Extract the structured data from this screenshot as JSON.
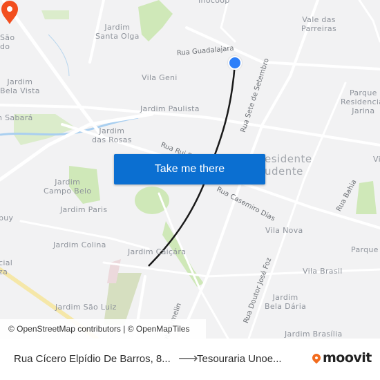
{
  "map": {
    "neighborhoods": [
      {
        "id": "inocoop",
        "text": "Inocoop"
      },
      {
        "id": "sao-do",
        "text": "São\ndo"
      },
      {
        "id": "jardim-santa-olga",
        "text": "Jardim\nSanta Olga"
      },
      {
        "id": "vale-das-parreiras",
        "text": "Vale das\nParreiras"
      },
      {
        "id": "jardim-bela-vista",
        "text": "Jardim\nBela Vista"
      },
      {
        "id": "vila-geni",
        "text": "Vila Geni"
      },
      {
        "id": "parque-residencial-jarina",
        "text": "Parque\nResidencial\nJarina"
      },
      {
        "id": "jardim-paulista",
        "text": "Jardim Paulista"
      },
      {
        "id": "sabara",
        "text": "n Sabará"
      },
      {
        "id": "jardim-das-rosas",
        "text": "Jardim\ndas Rosas"
      },
      {
        "id": "presidente-prudente",
        "text": "esidente\nudente"
      },
      {
        "id": "jardim-campo-belo",
        "text": "Jardim\nCampo Belo"
      },
      {
        "id": "jardim-paris",
        "text": "Jardim Paris"
      },
      {
        "id": "buy",
        "text": "buy"
      },
      {
        "id": "jardim-colina",
        "text": "Jardim Colina"
      },
      {
        "id": "vila-nova",
        "text": "Vila Nova"
      },
      {
        "id": "jardim-caicara",
        "text": "Jardim Caiçára"
      },
      {
        "id": "parque-right",
        "text": "Parque"
      },
      {
        "id": "cial-za",
        "text": "cial\nza"
      },
      {
        "id": "vila-brasil",
        "text": "Vila Brasil"
      },
      {
        "id": "jardim-bela-daria",
        "text": "Jardim\nBela Dária"
      },
      {
        "id": "jardim-sao-luiz",
        "text": "Jardim São Luiz"
      },
      {
        "id": "jardim-brasilia",
        "text": "Jardim Brasília"
      },
      {
        "id": "vi-edge",
        "text": "Vi"
      }
    ],
    "streets": [
      {
        "id": "rua-guadalajara",
        "text": "Rua Guadalajara"
      },
      {
        "id": "rua-sete-de-setembro",
        "text": "Rua Sete de Setembro"
      },
      {
        "id": "rua-rui",
        "text": "Rua Rui B"
      },
      {
        "id": "rua-casemiro-dias",
        "text": "Rua Casemiro Dias"
      },
      {
        "id": "rua-bahia",
        "text": "Rua Bahia"
      },
      {
        "id": "rua-doutor-jose-foz",
        "text": "Rua Doutor José Foz"
      },
      {
        "id": "renato-armelin",
        "text": "ato Armelin"
      }
    ],
    "cta_label": "Take me there",
    "attribution": "© OpenStreetMap contributors | © OpenMapTiles",
    "colors": {
      "route": "#1a1a1a",
      "origin_dot": "#2d7ff9",
      "dest_pin": "#f24e1e",
      "cta": "#0b6fd1",
      "park": "#cfe8b8"
    }
  },
  "footer": {
    "origin": "Rua Cícero Elpídio De Barros, 8...",
    "arrow": "⟶",
    "destination": "Tesouraria Unoe...",
    "brand": "moovit"
  }
}
